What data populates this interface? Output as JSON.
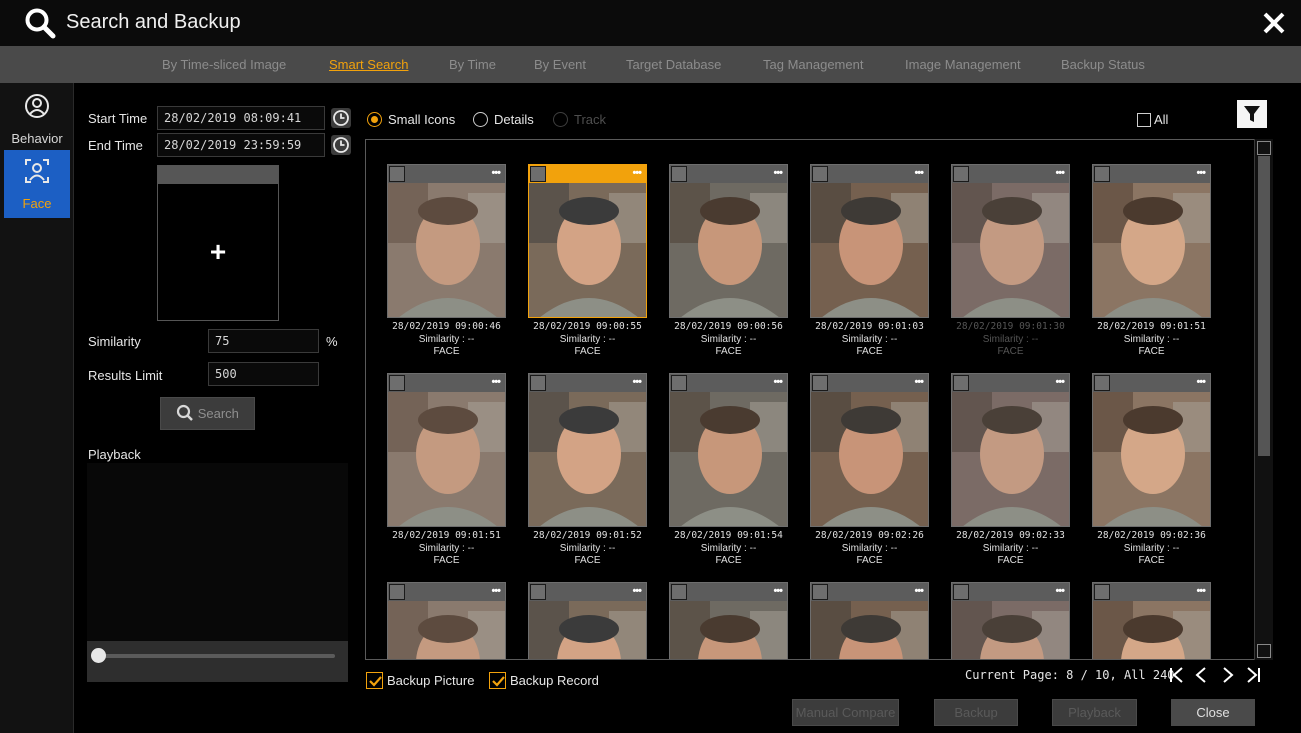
{
  "window": {
    "title": "Search and Backup",
    "search_icon": "search-icon",
    "close_icon": "close-icon"
  },
  "tabs": [
    {
      "label": "By Time-sliced Image",
      "active": false
    },
    {
      "label": "Smart Search",
      "active": true
    },
    {
      "label": "By Time",
      "active": false
    },
    {
      "label": "By Event",
      "active": false
    },
    {
      "label": "Target Database",
      "active": false
    },
    {
      "label": "Tag Management",
      "active": false
    },
    {
      "label": "Image Management",
      "active": false
    },
    {
      "label": "Backup Status",
      "active": false
    }
  ],
  "sidebar": {
    "items": [
      {
        "label": "Behavior",
        "icon": "behavior-icon",
        "active": false
      },
      {
        "label": "Face",
        "icon": "face-icon",
        "active": true
      }
    ]
  },
  "filters": {
    "start_label": "Start Time",
    "start_value": "28/02/2019 08:09:41",
    "end_label": "End Time",
    "end_value": "28/02/2019 23:59:59",
    "add_face": "+",
    "similarity_label": "Similarity",
    "similarity_value": "75",
    "similarity_unit": "%",
    "limit_label": "Results Limit",
    "limit_value": "500",
    "search_button": "Search",
    "playback_label": "Playback",
    "playback_position": 0
  },
  "view": {
    "options": [
      {
        "label": "Small Icons",
        "selected": true,
        "disabled": false
      },
      {
        "label": "Details",
        "selected": false,
        "disabled": false
      },
      {
        "label": "Track",
        "selected": false,
        "disabled": true
      }
    ],
    "all_label": "All",
    "filter_icon": "filter-icon"
  },
  "results": [
    {
      "time": "28/02/2019 09:00:46",
      "similarity": "Similarity : --",
      "type": "FACE",
      "selected": false,
      "dim": false
    },
    {
      "time": "28/02/2019 09:00:55",
      "similarity": "Similarity : --",
      "type": "FACE",
      "selected": true,
      "dim": false
    },
    {
      "time": "28/02/2019 09:00:56",
      "similarity": "Similarity : --",
      "type": "FACE",
      "selected": false,
      "dim": false
    },
    {
      "time": "28/02/2019 09:01:03",
      "similarity": "Similarity : --",
      "type": "FACE",
      "selected": false,
      "dim": false
    },
    {
      "time": "28/02/2019 09:01:30",
      "similarity": "Similarity : --",
      "type": "FACE",
      "selected": false,
      "dim": true
    },
    {
      "time": "28/02/2019 09:01:51",
      "similarity": "Similarity : --",
      "type": "FACE",
      "selected": false,
      "dim": false
    },
    {
      "time": "28/02/2019 09:01:51",
      "similarity": "Similarity : --",
      "type": "FACE",
      "selected": false,
      "dim": false
    },
    {
      "time": "28/02/2019 09:01:52",
      "similarity": "Similarity : --",
      "type": "FACE",
      "selected": false,
      "dim": false
    },
    {
      "time": "28/02/2019 09:01:54",
      "similarity": "Similarity : --",
      "type": "FACE",
      "selected": false,
      "dim": false
    },
    {
      "time": "28/02/2019 09:02:26",
      "similarity": "Similarity : --",
      "type": "FACE",
      "selected": false,
      "dim": false
    },
    {
      "time": "28/02/2019 09:02:33",
      "similarity": "Similarity : --",
      "type": "FACE",
      "selected": false,
      "dim": false
    },
    {
      "time": "28/02/2019 09:02:36",
      "similarity": "Similarity : --",
      "type": "FACE",
      "selected": false,
      "dim": false
    },
    {
      "time": "",
      "similarity": "",
      "type": "",
      "selected": false,
      "dim": false
    },
    {
      "time": "",
      "similarity": "",
      "type": "",
      "selected": false,
      "dim": false
    },
    {
      "time": "",
      "similarity": "",
      "type": "",
      "selected": false,
      "dim": false
    },
    {
      "time": "",
      "similarity": "",
      "type": "",
      "selected": false,
      "dim": false
    },
    {
      "time": "",
      "similarity": "",
      "type": "",
      "selected": false,
      "dim": false
    },
    {
      "time": "",
      "similarity": "",
      "type": "",
      "selected": false,
      "dim": false
    }
  ],
  "footer": {
    "backup_picture": "Backup Picture",
    "backup_picture_checked": true,
    "backup_record": "Backup Record",
    "backup_record_checked": true,
    "page_info": "Current Page: 8 / 10, All 240",
    "nav_icons": [
      "first-page-icon",
      "prev-page-icon",
      "next-page-icon",
      "last-page-icon"
    ],
    "buttons": {
      "manual_compare": "Manual Compare",
      "backup": "Backup",
      "playback": "Playback",
      "close": "Close"
    }
  },
  "colors": {
    "accent": "#f2a20c",
    "active_nav": "#1c5fc4",
    "tabbar": "#4a4a4a"
  }
}
